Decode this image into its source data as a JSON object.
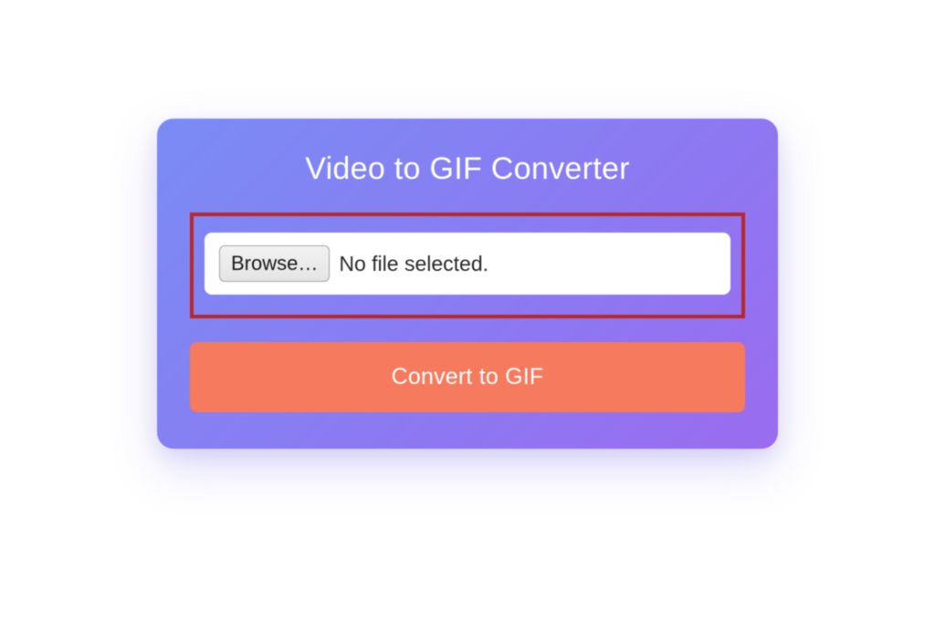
{
  "card": {
    "title": "Video to GIF Converter",
    "fileInput": {
      "browseLabel": "Browse…",
      "statusText": "No file selected."
    },
    "convertLabel": "Convert to GIF"
  }
}
